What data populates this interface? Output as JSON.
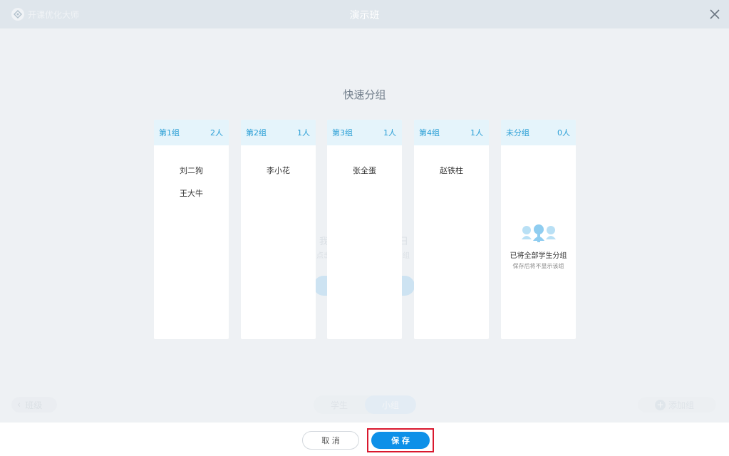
{
  "window": {
    "brand": "开课优化大师",
    "title": "演示班"
  },
  "background": {
    "hint_left": "我",
    "hint_right": "日",
    "hint_sub_left": "点击下",
    "hint_sub_right": "组",
    "prev_label": "班级",
    "toggle": [
      "学生",
      "小组"
    ],
    "next_label": "添加组"
  },
  "panel": {
    "title": "快速分组"
  },
  "groups": [
    {
      "name": "第1组",
      "count": "2人",
      "members": [
        "刘二狗",
        "王大牛"
      ]
    },
    {
      "name": "第2组",
      "count": "1人",
      "members": [
        "李小花"
      ]
    },
    {
      "name": "第3组",
      "count": "1人",
      "members": [
        "张全蛋"
      ]
    },
    {
      "name": "第4组",
      "count": "1人",
      "members": [
        "赵铁柱"
      ]
    }
  ],
  "ungrouped": {
    "name": "未分组",
    "count": "0人",
    "empty_title": "已将全部学生分组",
    "empty_sub": "保存后将不显示该组"
  },
  "footer": {
    "cancel_label": "取 消",
    "save_label": "保 存"
  },
  "colors": {
    "accent": "#0e90e8",
    "group_header_bg": "#e5f4fb",
    "group_header_text": "#2b9fd6",
    "highlight_frame": "#d9182e"
  },
  "icons": {
    "brand": "brand-logo-icon",
    "close": "close-icon",
    "empty": "people-group-icon"
  }
}
